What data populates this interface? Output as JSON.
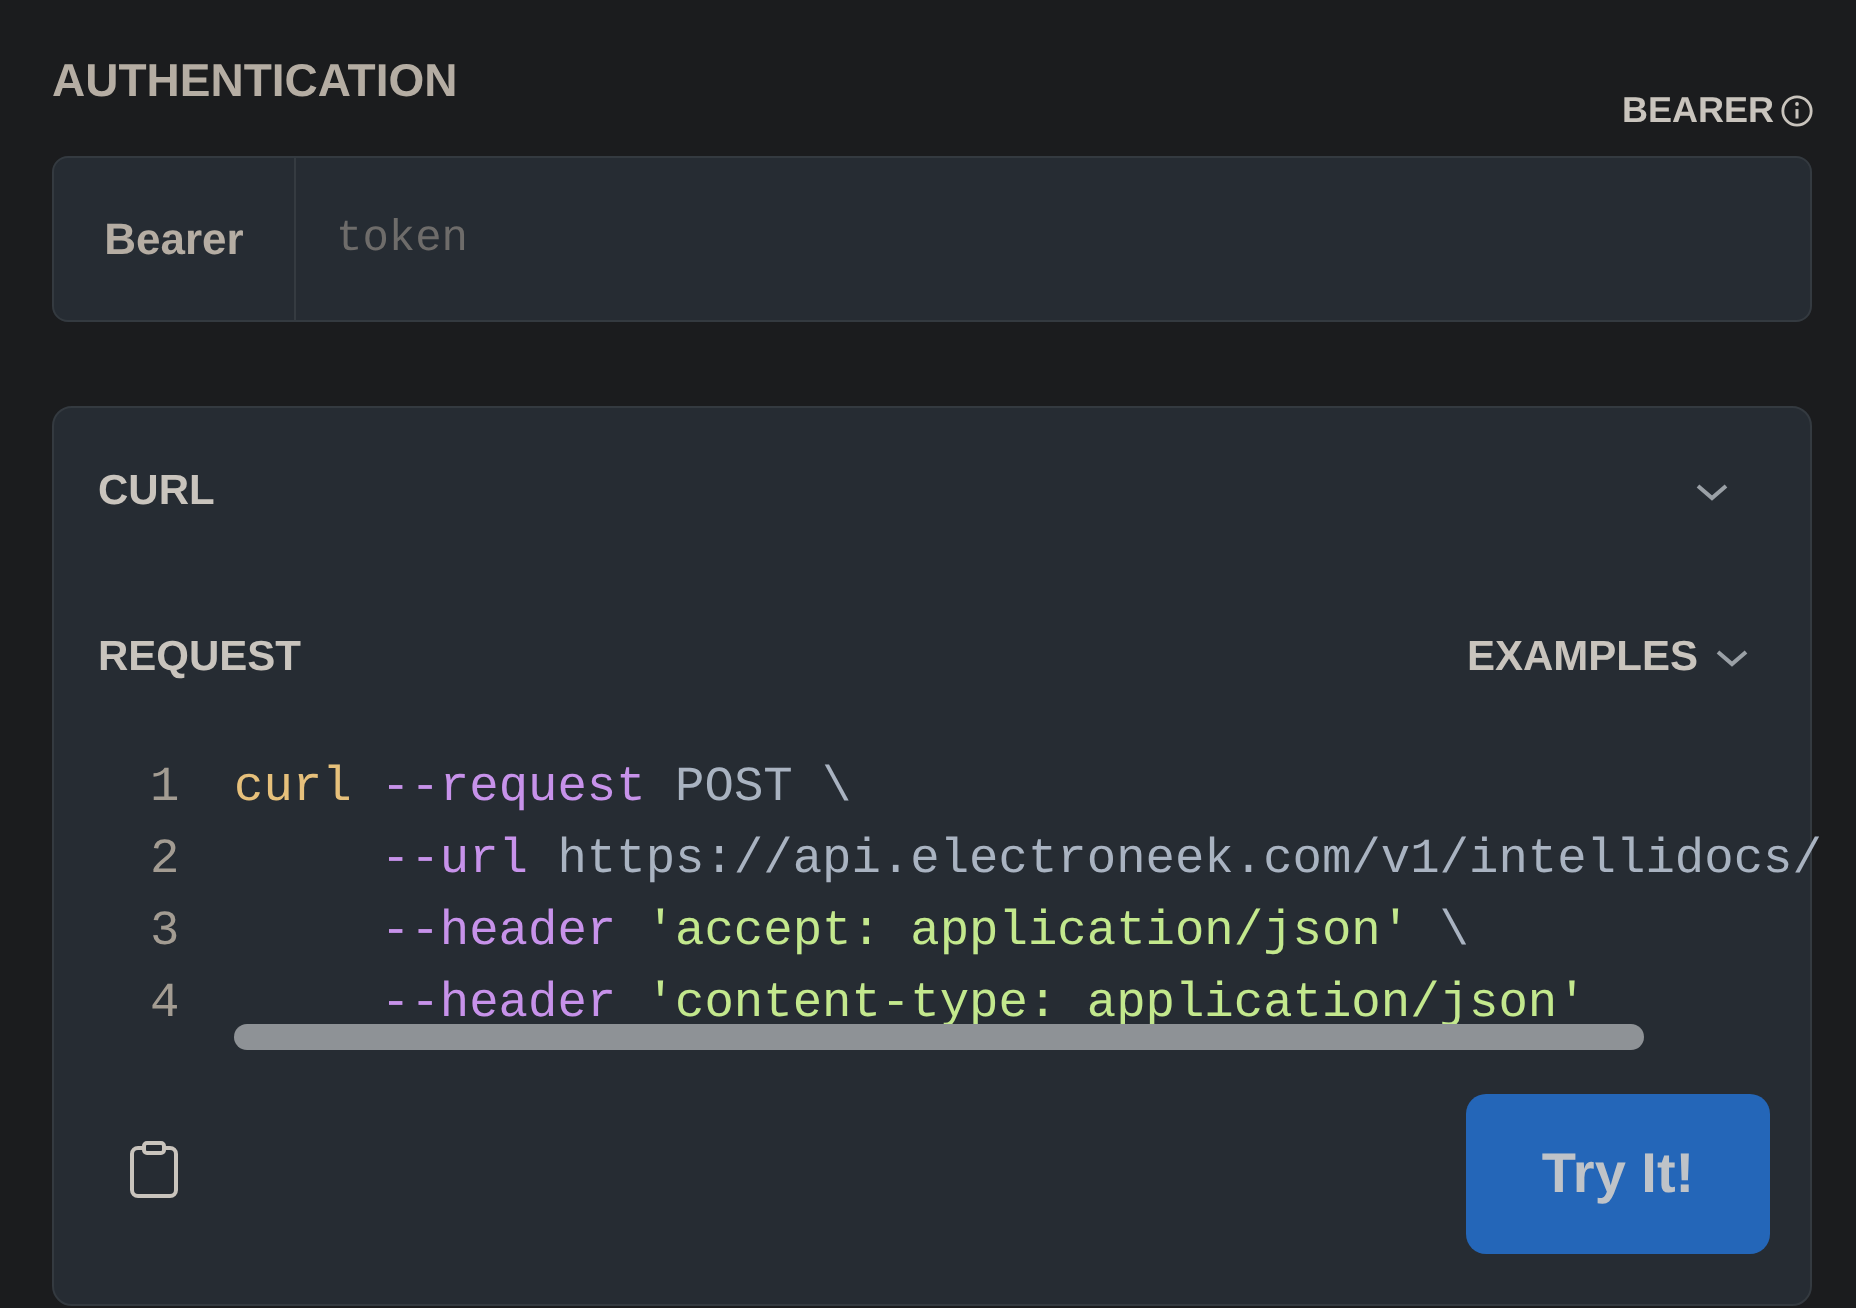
{
  "authentication": {
    "title": "AUTHENTICATION",
    "scheme": "BEARER",
    "field": {
      "label": "Bearer",
      "placeholder": "token"
    }
  },
  "request_panel": {
    "language": "CURL",
    "expanded": true,
    "section": "REQUEST",
    "examples": "EXAMPLES",
    "code_lines": [
      {
        "number": "1",
        "indent": false,
        "tokens": [
          {
            "kind": "command",
            "text": "curl "
          },
          {
            "kind": "flag",
            "text": "--request"
          },
          {
            "kind": "plain",
            "text": " POST \\"
          }
        ]
      },
      {
        "number": "2",
        "indent": true,
        "tokens": [
          {
            "kind": "flag",
            "text": "--url"
          },
          {
            "kind": "plain",
            "text": " https://api.electroneek.com/v1/intellidocs/"
          }
        ]
      },
      {
        "number": "3",
        "indent": true,
        "tokens": [
          {
            "kind": "flag",
            "text": "--header "
          },
          {
            "kind": "string",
            "text": "'accept: application/json'"
          },
          {
            "kind": "plain",
            "text": " \\"
          }
        ]
      },
      {
        "number": "4",
        "indent": true,
        "tokens": [
          {
            "kind": "flag",
            "text": "--header "
          },
          {
            "kind": "string",
            "text": "'content-type: application/json'"
          }
        ]
      }
    ],
    "button": "Try It!"
  }
}
